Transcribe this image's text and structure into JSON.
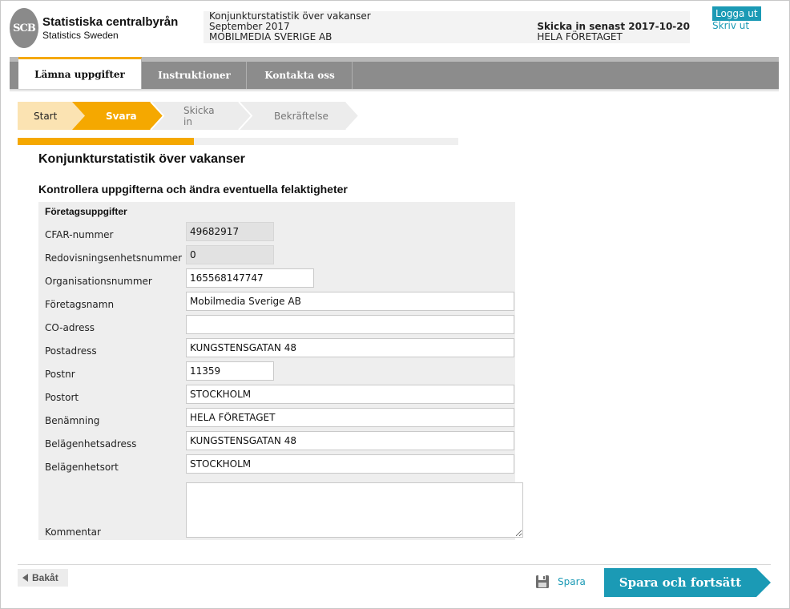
{
  "header": {
    "logo_mark": "SCB",
    "org_name": "Statistiska centralbyrån",
    "org_name_en": "Statistics Sweden",
    "survey_name": "Konjunkturstatistik över vakanser",
    "period": "September 2017",
    "company": "MOBILMEDIA SVERIGE AB",
    "deadline": "Skicka in senast 2017-10-20",
    "unit": "HELA FÖRETAGET",
    "logout_label": "Logga ut",
    "print_label": "Skriv ut"
  },
  "nav": {
    "tabs": [
      {
        "label": "Lämna uppgifter",
        "active": true
      },
      {
        "label": "Instruktioner",
        "active": false
      },
      {
        "label": "Kontakta oss",
        "active": false
      }
    ]
  },
  "steps": [
    {
      "label": "Start",
      "state": "done"
    },
    {
      "label": "Svara",
      "state": "current"
    },
    {
      "label": "Skicka in",
      "state": "todo"
    },
    {
      "label": "Bekräftelse",
      "state": "todo"
    }
  ],
  "progress": {
    "fraction": 0.4
  },
  "page": {
    "title": "Konjunkturstatistik över vakanser",
    "section_title": "Kontrollera uppgifterna och ändra eventuella felaktigheter"
  },
  "form": {
    "heading": "Företagsuppgifter",
    "fields": [
      {
        "label": "CFAR-nummer",
        "value": "49682917",
        "readonly": true
      },
      {
        "label": "Redovisningsenhetsnummer",
        "value": "0",
        "readonly": true
      },
      {
        "label": "Organisationsnummer",
        "value": "165568147747",
        "readonly": false
      },
      {
        "label": "Företagsnamn",
        "value": "Mobilmedia Sverige AB",
        "readonly": false
      },
      {
        "label": "CO-adress",
        "value": "",
        "readonly": false
      },
      {
        "label": "Postadress",
        "value": "KUNGSTENSGATAN 48",
        "readonly": false
      },
      {
        "label": "Postnr",
        "value": "11359",
        "readonly": false
      },
      {
        "label": "Postort",
        "value": "STOCKHOLM",
        "readonly": false
      },
      {
        "label": "Benämning",
        "value": "HELA FÖRETAGET",
        "readonly": false
      },
      {
        "label": "Belägenhetsadress",
        "value": "KUNGSTENSGATAN 48",
        "readonly": false
      },
      {
        "label": "Belägenhetsort",
        "value": "STOCKHOLM",
        "readonly": false
      }
    ],
    "comment": {
      "label": "Kommentar",
      "value": ""
    }
  },
  "footer": {
    "back_label": "Bakåt",
    "save_label": "Spara",
    "continue_label": "Spara och fortsätt"
  },
  "colors": {
    "accent": "#f5a800",
    "step_done": "#fbe3b2",
    "step_todo": "#ececec",
    "link": "#1b9ab5",
    "continue": "#1b9ab5"
  },
  "icons": {
    "back": "triangle-left-icon",
    "save": "floppy-disk-icon"
  }
}
